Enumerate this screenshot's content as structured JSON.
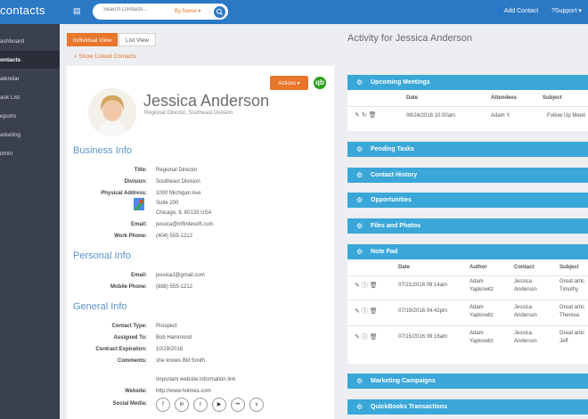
{
  "app": {
    "brand": "contacts"
  },
  "header": {
    "search_placeholder": "Search Contacts...",
    "search_by": "By Name ▾",
    "add_contact": "Add Contact",
    "support": "Support ▾"
  },
  "sidebar": {
    "items": [
      {
        "label": "ashboard"
      },
      {
        "label": "ontacts"
      },
      {
        "label": "alendar"
      },
      {
        "label": "ask List"
      },
      {
        "label": "eports"
      },
      {
        "label": "arketing"
      },
      {
        "label": "dmin"
      }
    ]
  },
  "tabs": {
    "individual": "Individual View",
    "list": "List View"
  },
  "show_linked": "Show Linked Contacts",
  "contact": {
    "name": "Jessica Anderson",
    "subtitle": "Regional Director, Southeast Division",
    "actions": "Actions ▾"
  },
  "business": {
    "heading": "Business Info",
    "title_label": "Title:",
    "title": "Regional Director",
    "division_label": "Division:",
    "division": "Southeast Division",
    "address_label": "Physical Address:",
    "address1": "1000 Michigan Ave",
    "address2": "Suite 200",
    "address3": "Chicago, IL 60133 USA",
    "email_label": "Email:",
    "email": "jessica@infinitesoft.com",
    "phone_label": "Work Phone:",
    "phone": "(404) 555-1212"
  },
  "personal": {
    "heading": "Personal Info",
    "email_label": "Email:",
    "email": "jessicaJ@gmail.com",
    "mobile_label": "Mobile Phone:",
    "mobile": "(888) 555-1212"
  },
  "general": {
    "heading": "General Info",
    "type_label": "Contact Type:",
    "type": "Prospect",
    "assigned_label": "Assigned To:",
    "assigned": "Bob Hammond",
    "expiration_label": "Contract Expiration:",
    "expiration": "10/19/2016",
    "comments_label": "Comments:",
    "comments": "she knows Bill Smith",
    "website_note": "Important website information link",
    "website_label": "Website:",
    "website": "http://www.holmes.com",
    "social_label": "Social Media:"
  },
  "activity": {
    "title": "Activity for Jessica Anderson",
    "meetings": {
      "label": "Upcoming Meetings",
      "headers": {
        "date": "Date",
        "attendees": "Attendees",
        "subject": "Subject"
      },
      "row": {
        "date": "08/24/2016  10:00am",
        "attendees": "Adam Y",
        "subject": "Follow Up Meeti"
      }
    },
    "pending": "Pending Tasks",
    "history": "Contact History",
    "opportunities": "Opportunities",
    "files": "Files and Photos",
    "notepad": {
      "label": "Note Pad",
      "headers": {
        "date": "Date",
        "author": "Author",
        "contact": "Contact",
        "subject": "Subject"
      },
      "rows": [
        {
          "date": "07/21/2016  09:14am",
          "author1": "Adam",
          "author2": "Yapkowitz",
          "contact1": "Jessica",
          "contact2": "Anderson",
          "subject1": "Great artic",
          "subject2": "Timothy"
        },
        {
          "date": "07/19/2016  04:42pm",
          "author1": "Adam",
          "author2": "Yapkowitz",
          "contact1": "Jessica",
          "contact2": "Anderson",
          "subject1": "Great artic",
          "subject2": "Theresa"
        },
        {
          "date": "07/15/2016  09:16am",
          "author1": "Adam",
          "author2": "Yapkowitz",
          "contact1": "Jessica",
          "contact2": "Anderson",
          "subject1": "Great artic",
          "subject2": "Jeff"
        }
      ]
    },
    "marketing": "Marketing Campaigns",
    "quickbooks": "QuickBooks Transactions"
  },
  "colors": {
    "topbar": "#2b78c4",
    "sidebar": "#3b404d",
    "accent": "#e8762b",
    "panel": "#3aa7d8",
    "heading": "#5b93c7"
  }
}
